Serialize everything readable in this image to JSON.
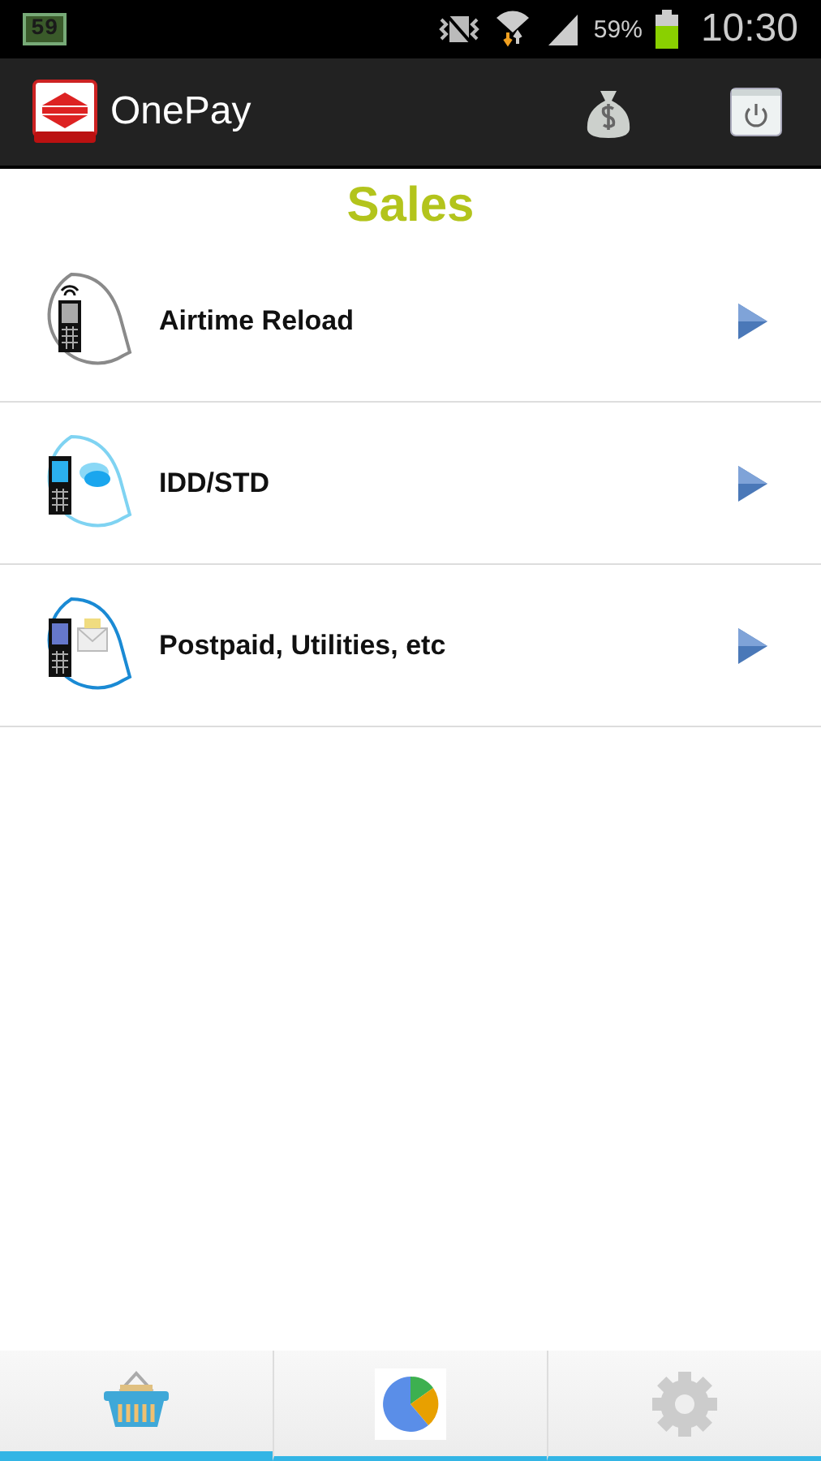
{
  "status_bar": {
    "battery_app_badge": "59",
    "battery_percent": "59%",
    "time": "10:30"
  },
  "app_bar": {
    "title": "OnePay"
  },
  "page_title": "Sales",
  "items": [
    {
      "label": "Airtime Reload",
      "kind": "signal",
      "color": "#8a8a8a"
    },
    {
      "label": "IDD/STD",
      "kind": "chat",
      "color": "#7fd3f2"
    },
    {
      "label": "Postpaid, Utilities, etc",
      "kind": "mail",
      "color": "#1a8ad4"
    }
  ],
  "bottom_tabs": [
    {
      "kind": "basket",
      "selected": true
    },
    {
      "kind": "chart",
      "selected": false
    },
    {
      "kind": "settings",
      "selected": false
    }
  ]
}
